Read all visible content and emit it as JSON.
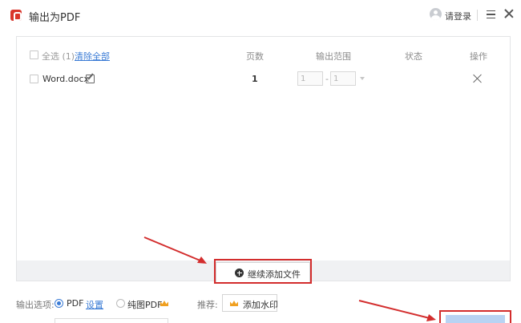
{
  "window": {
    "title": "输出为PDF",
    "login_label": "请登录"
  },
  "file_table": {
    "select_all_label": "全选 (1)",
    "clear_all_label": "清除全部",
    "columns": {
      "pages": "页数",
      "range": "输出范围",
      "status": "状态",
      "actions": "操作"
    },
    "rows": [
      {
        "filename": "Word.docx",
        "pages": "1",
        "range_from": "1",
        "range_dash": "-",
        "range_to": "1",
        "status": ""
      }
    ],
    "add_more_label": "继续添加文件"
  },
  "options": {
    "label": "输出选项:",
    "pdf_label": "PDF",
    "settings_label": "设置",
    "pure_pdf_label": "纯图PDF",
    "pdf_selected": true,
    "recommend_label": "推荐:",
    "watermark_label": "添加水印"
  },
  "colors": {
    "accent": "#3a7bd5",
    "annotation_red": "#d32d2d",
    "premium_gold": "#f0a020",
    "export_button": "#b8d3f3"
  },
  "icons": [
    "app-pdf-icon",
    "user-avatar-icon",
    "menu-icon",
    "close-icon",
    "edit-icon",
    "delete-icon",
    "plus-circle-icon",
    "crown-icon"
  ]
}
